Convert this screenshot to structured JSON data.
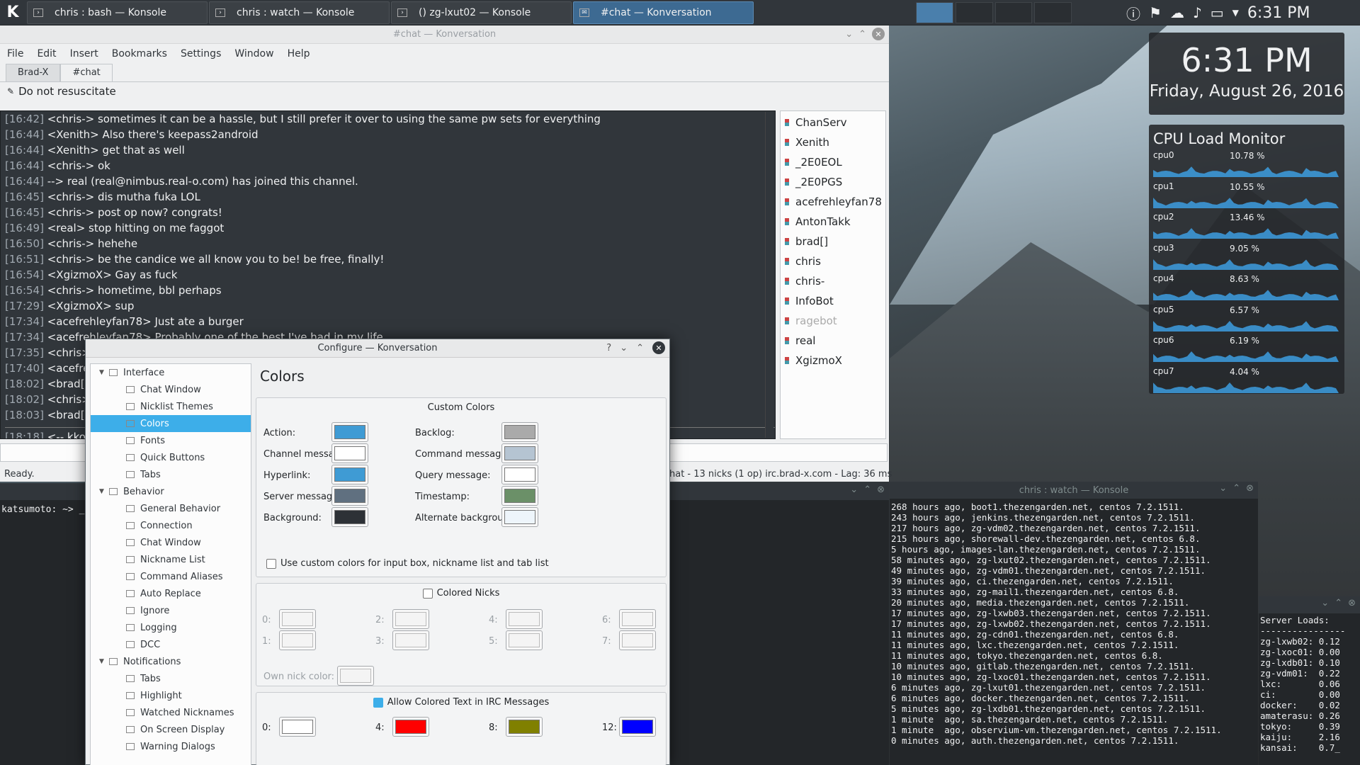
{
  "taskbar": {
    "tasks": [
      {
        "label": "chris : bash — Konsole"
      },
      {
        "label": "chris : watch — Konsole"
      },
      {
        "label": "() zg-lxut02 — Konsole"
      },
      {
        "label": "#chat — Konversation"
      }
    ],
    "clock": "6:31 PM"
  },
  "konversation": {
    "title": "#chat — Konversation",
    "menu": [
      "File",
      "Edit",
      "Insert",
      "Bookmarks",
      "Settings",
      "Window",
      "Help"
    ],
    "tabs": [
      "Brad-X",
      "#chat"
    ],
    "topic": "Do not resuscitate",
    "messages": [
      {
        "ts": "[16:42]",
        "text": "<chris-> sometimes it can be a hassle, but I still prefer it over to using the same pw sets for everything"
      },
      {
        "ts": "[16:44]",
        "text": "<Xenith> Also there's keepass2android"
      },
      {
        "ts": "[16:44]",
        "text": "<Xenith> get that as well"
      },
      {
        "ts": "[16:44]",
        "text": "<chris-> ok"
      },
      {
        "ts": "[16:44]",
        "text": "--> real (real@nimbus.real-o.com) has joined this channel."
      },
      {
        "ts": "[16:45]",
        "text": "<chris-> dis mutha fuka LOL"
      },
      {
        "ts": "[16:45]",
        "text": "<chris-> post op now? congrats!"
      },
      {
        "ts": "[16:49]",
        "text": "<real> stop hitting on me faggot"
      },
      {
        "ts": "[16:50]",
        "text": "<chris-> hehehe"
      },
      {
        "ts": "[16:51]",
        "text": "<chris-> be the candice we all know you to be! be free, finally!"
      },
      {
        "ts": "[16:54]",
        "text": "<XgizmoX> Gay as fuck"
      },
      {
        "ts": "[16:54]",
        "text": "<chris-> hometime, bbl perhaps"
      },
      {
        "ts": "[17:29]",
        "text": "<XgizmoX> sup"
      },
      {
        "ts": "[17:34]",
        "text": "<acefrehleyfan78> Just ate a burger"
      },
      {
        "ts": "[17:34]",
        "text": "<acefrehleyfan78> Probably one of the best I've had in my life"
      },
      {
        "ts": "[17:35]",
        "text": "<chris>"
      },
      {
        "ts": "[17:40]",
        "text": "<acefrel"
      },
      {
        "ts": "[18:02]",
        "text": "<brad[]>"
      },
      {
        "ts": "[18:02]",
        "text": "<chris>"
      },
      {
        "ts": "[18:03]",
        "text": "<brad[]>"
      }
    ],
    "last_line": {
      "ts": "[18:18]",
      "text": "<-- kko ("
    },
    "nicks": [
      {
        "name": "ChanServ",
        "away": false
      },
      {
        "name": "Xenith",
        "away": false
      },
      {
        "name": "_2E0EOL",
        "away": false
      },
      {
        "name": "_2E0PGS",
        "away": false
      },
      {
        "name": "acefrehleyfan78",
        "away": false
      },
      {
        "name": "AntonTakk",
        "away": false
      },
      {
        "name": "brad[]",
        "away": false
      },
      {
        "name": "chris",
        "away": false
      },
      {
        "name": "chris-",
        "away": false
      },
      {
        "name": "InfoBot",
        "away": false
      },
      {
        "name": "ragebot",
        "away": true
      },
      {
        "name": "real",
        "away": false
      },
      {
        "name": "XgizmoX",
        "away": false
      }
    ],
    "status_left": "Ready.",
    "status_right": "hat - 13 nicks (1 op)  irc.brad-x.com - Lag: 36 ms"
  },
  "bash_konsole": {
    "prompt": "katsumoto: ~> _"
  },
  "configure": {
    "title": "Configure — Konversation",
    "tree": [
      {
        "label": "Interface",
        "level": 0,
        "expanded": true,
        "selected": false
      },
      {
        "label": "Chat Window",
        "level": 1,
        "selected": false
      },
      {
        "label": "Nicklist Themes",
        "level": 1,
        "selected": false
      },
      {
        "label": "Colors",
        "level": 1,
        "selected": true
      },
      {
        "label": "Fonts",
        "level": 1,
        "selected": false
      },
      {
        "label": "Quick Buttons",
        "level": 1,
        "selected": false
      },
      {
        "label": "Tabs",
        "level": 1,
        "selected": false
      },
      {
        "label": "Behavior",
        "level": 0,
        "expanded": true,
        "selected": false
      },
      {
        "label": "General Behavior",
        "level": 1,
        "selected": false
      },
      {
        "label": "Connection",
        "level": 1,
        "selected": false
      },
      {
        "label": "Chat Window",
        "level": 1,
        "selected": false
      },
      {
        "label": "Nickname List",
        "level": 1,
        "selected": false
      },
      {
        "label": "Command Aliases",
        "level": 1,
        "selected": false
      },
      {
        "label": "Auto Replace",
        "level": 1,
        "selected": false
      },
      {
        "label": "Ignore",
        "level": 1,
        "selected": false
      },
      {
        "label": "Logging",
        "level": 1,
        "selected": false
      },
      {
        "label": "DCC",
        "level": 1,
        "selected": false
      },
      {
        "label": "Notifications",
        "level": 0,
        "expanded": true,
        "selected": false
      },
      {
        "label": "Tabs",
        "level": 1,
        "selected": false
      },
      {
        "label": "Highlight",
        "level": 1,
        "selected": false
      },
      {
        "label": "Watched Nicknames",
        "level": 1,
        "selected": false
      },
      {
        "label": "On Screen Display",
        "level": 1,
        "selected": false
      },
      {
        "label": "Warning Dialogs",
        "level": 1,
        "selected": false
      }
    ],
    "page_title": "Colors",
    "custom_colors": {
      "title": "Custom Colors",
      "left": [
        {
          "label": "Action:",
          "color": "#3f9bd4"
        },
        {
          "label": "Channel message:",
          "color": "#ffffff"
        },
        {
          "label": "Hyperlink:",
          "color": "#3f9bd4"
        },
        {
          "label": "Server message:",
          "color": "#607080"
        },
        {
          "label": "Background:",
          "color": "#2d3136"
        }
      ],
      "right": [
        {
          "label": "Backlog:",
          "color": "#aaaaaa"
        },
        {
          "label": "Command message:",
          "color": "#b5c4d2"
        },
        {
          "label": "Query message:",
          "color": "#ffffff"
        },
        {
          "label": "Timestamp:",
          "color": "#6b9068"
        },
        {
          "label": "Alternate background:",
          "color": "#eef5fb"
        }
      ],
      "checkbox": "Use custom colors for input box, nickname list and tab list"
    },
    "colored_nicks": {
      "label": "Colored Nicks",
      "slots": [
        "0:",
        "1:",
        "2:",
        "3:",
        "4:",
        "5:",
        "6:",
        "7:"
      ],
      "own": "Own nick color:"
    },
    "irc_colors": {
      "label": "Allow Colored Text in IRC Messages",
      "slots": [
        {
          "label": "0:",
          "color": "#ffffff"
        },
        {
          "label": "4:",
          "color": "#ff0000"
        },
        {
          "label": "8:",
          "color": "#808000"
        },
        {
          "label": "12:",
          "color": "#0000ff"
        }
      ]
    }
  },
  "watch_konsole": {
    "title": "chris : watch — Konsole",
    "lines": [
      "268 hours ago, boot1.thezengarden.net, centos 7.2.1511.",
      "243 hours ago, jenkins.thezengarden.net, centos 7.2.1511.",
      "217 hours ago, zg-vdm02.thezengarden.net, centos 7.2.1511.",
      "215 hours ago, shorewall-dev.thezengarden.net, centos 6.8.",
      "5 hours ago, images-lan.thezengarden.net, centos 7.2.1511.",
      "58 minutes ago, zg-lxut02.thezengarden.net, centos 7.2.1511.",
      "49 minutes ago, zg-vdm01.thezengarden.net, centos 7.2.1511.",
      "39 minutes ago, ci.thezengarden.net, centos 7.2.1511.",
      "33 minutes ago, zg-mail1.thezengarden.net, centos 6.8.",
      "20 minutes ago, media.thezengarden.net, centos 7.2.1511.",
      "17 minutes ago, zg-lxwb03.thezengarden.net, centos 7.2.1511.",
      "17 minutes ago, zg-lxwb02.thezengarden.net, centos 7.2.1511.",
      "11 minutes ago, zg-cdn01.thezengarden.net, centos 6.8.",
      "11 minutes ago, lxc.thezengarden.net, centos 7.2.1511.",
      "11 minutes ago, tokyo.thezengarden.net, centos 6.8.",
      "10 minutes ago, gitlab.thezengarden.net, centos 7.2.1511.",
      "10 minutes ago, zg-lxoc01.thezengarden.net, centos 7.2.1511.",
      "6 minutes ago, zg-lxut01.thezengarden.net, centos 7.2.1511.",
      "6 minutes ago, docker.thezengarden.net, centos 7.2.1511.",
      "5 minutes ago, zg-lxdb01.thezengarden.net, centos 7.2.1511.",
      "1 minute  ago, sa.thezengarden.net, centos 7.2.1511.",
      "1 minute  ago, observium-vm.thezengarden.net, centos 7.2.1511.",
      "0 minutes ago, auth.thezengarden.net, centos 7.2.1511."
    ]
  },
  "server_loads": {
    "header": "Server Loads:",
    "rule": "----------------",
    "rows": [
      "zg-lxwb02: 0.12",
      "zg-lxoc01: 0.00",
      "zg-lxdb01: 0.10",
      "zg-vdm01:  0.22",
      "lxc:       0.06",
      "ci:        0.00",
      "docker:    0.02",
      "amaterasu: 0.26",
      "tokyo:     0.39",
      "kaiju:     2.16",
      "kansai:    0.7_"
    ]
  },
  "clock_widget": {
    "time": "6:31 PM",
    "date": "Friday, August 26, 2016"
  },
  "cpu_monitor": {
    "title": "CPU Load Monitor",
    "cpus": [
      {
        "name": "cpu0",
        "value": "10.78 %"
      },
      {
        "name": "cpu1",
        "value": "10.55 %"
      },
      {
        "name": "cpu2",
        "value": "13.46 %"
      },
      {
        "name": "cpu3",
        "value": "9.05 %"
      },
      {
        "name": "cpu4",
        "value": "8.63 %"
      },
      {
        "name": "cpu5",
        "value": "6.57 %"
      },
      {
        "name": "cpu6",
        "value": "6.19 %"
      },
      {
        "name": "cpu7",
        "value": "4.04 %"
      }
    ],
    "graph_color": "#3d9ee0"
  }
}
